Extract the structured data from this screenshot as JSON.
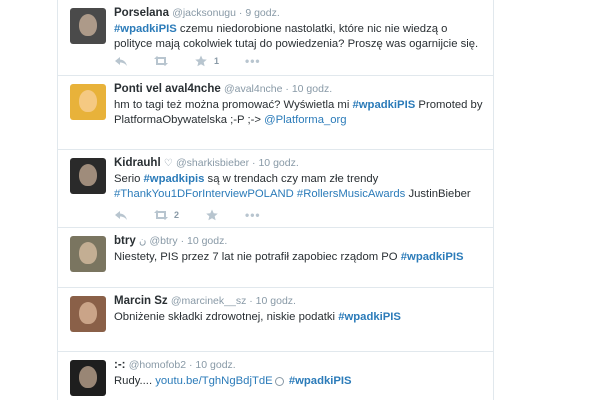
{
  "tweets": [
    {
      "name": "Porselana",
      "username": "@jacksonugu",
      "time": "9 godz.",
      "heart": "",
      "text_parts": [
        {
          "t": "#wpadkiPIS",
          "k": "tag"
        },
        {
          "t": " czemu niedorobione nastolatki, które nic nie wiedzą o polityce mają cokolwiek tutaj do powiedzenia? Proszę was ogarnijcie się.",
          "k": "plain"
        }
      ],
      "retweet_count": "",
      "fav_count": "1",
      "avatar_color": "#4a4a4a"
    },
    {
      "name": "Ponti vel aval4nche",
      "username": "@aval4nche",
      "time": "10 godz.",
      "heart": "",
      "text_parts": [
        {
          "t": "hm to tagi też można promować? Wyświetla mi ",
          "k": "plain"
        },
        {
          "t": "#wpadkiPIS",
          "k": "tag"
        },
        {
          "t": " Promoted by PlatformaObywatelska ;-P ;-> ",
          "k": "plain"
        },
        {
          "t": "@Platforma_org",
          "k": "link"
        }
      ],
      "retweet_count": "",
      "fav_count": "",
      "avatar_color": "#e8b23a"
    },
    {
      "name": "Kidrauhl",
      "username": "@sharkisbieber",
      "time": "10 godz.",
      "heart": "♡",
      "text_parts": [
        {
          "t": "Serio ",
          "k": "plain"
        },
        {
          "t": "#wpadkipis",
          "k": "tag"
        },
        {
          "t": " są w trendach czy mam złe trendy ",
          "k": "plain"
        },
        {
          "t": "#ThankYou1DForInterviewPOLAND #RollersMusicAwards",
          "k": "link"
        },
        {
          "t": " JustinBieber",
          "k": "plain"
        }
      ],
      "retweet_count": "2",
      "fav_count": "",
      "avatar_color": "#2a2a2a"
    },
    {
      "name": "btry",
      "username": "@btry",
      "time": "10 godz.",
      "heart": "ن",
      "text_parts": [
        {
          "t": "Niestety, PIS przez 7 lat nie potrafił zapobiec rządom PO ",
          "k": "plain"
        },
        {
          "t": "#wpadkiPIS",
          "k": "tag"
        }
      ],
      "retweet_count": "",
      "fav_count": "",
      "avatar_color": "#7a7560"
    },
    {
      "name": "Marcin Sz",
      "username": "@marcinek__sz",
      "time": "10 godz.",
      "heart": "",
      "text_parts": [
        {
          "t": "Obniżenie składki zdrowotnej, niskie podatki ",
          "k": "plain"
        },
        {
          "t": "#wpadkiPIS",
          "k": "tag"
        }
      ],
      "retweet_count": "",
      "fav_count": "",
      "avatar_color": "#8a6048"
    },
    {
      "name": ":-:",
      "username": "@homofob2",
      "time": "10 godz.",
      "heart": "",
      "text_parts": [
        {
          "t": "Rudy.... ",
          "k": "plain"
        },
        {
          "t": "youtu.be/TghNgBdjTdE",
          "k": "link"
        },
        {
          "t": "◯",
          "k": "circle"
        },
        {
          "t": "#wpadkiPIS",
          "k": "tag"
        }
      ],
      "retweet_count": "",
      "fav_count": "",
      "avatar_color": "#1e1e1e"
    }
  ]
}
